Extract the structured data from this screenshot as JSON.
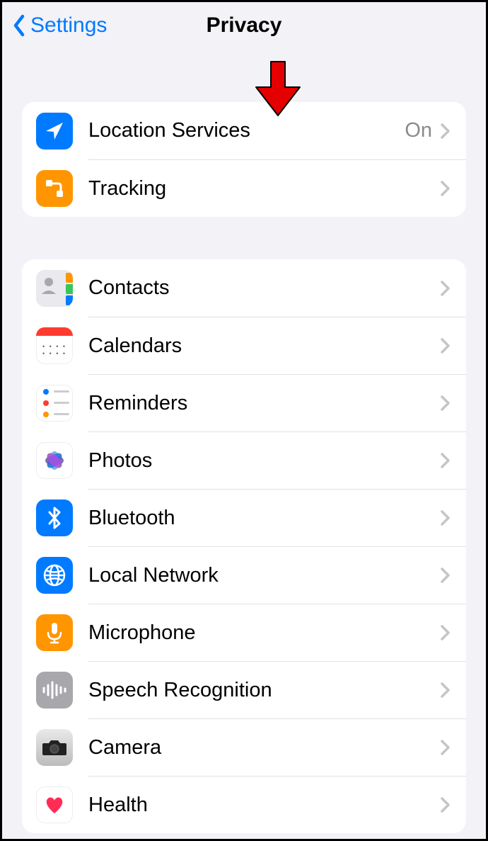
{
  "header": {
    "back_label": "Settings",
    "title": "Privacy"
  },
  "groups": [
    {
      "id": "location",
      "rows": [
        {
          "id": "location-services",
          "label": "Location Services",
          "value": "On",
          "icon": "location"
        },
        {
          "id": "tracking",
          "label": "Tracking",
          "icon": "tracking"
        }
      ]
    },
    {
      "id": "privacy-apps",
      "rows": [
        {
          "id": "contacts",
          "label": "Contacts",
          "icon": "contacts"
        },
        {
          "id": "calendars",
          "label": "Calendars",
          "icon": "calendars"
        },
        {
          "id": "reminders",
          "label": "Reminders",
          "icon": "reminders"
        },
        {
          "id": "photos",
          "label": "Photos",
          "icon": "photos"
        },
        {
          "id": "bluetooth",
          "label": "Bluetooth",
          "icon": "bluetooth"
        },
        {
          "id": "local-network",
          "label": "Local Network",
          "icon": "localnetwork"
        },
        {
          "id": "microphone",
          "label": "Microphone",
          "icon": "microphone"
        },
        {
          "id": "speech",
          "label": "Speech Recognition",
          "icon": "speech"
        },
        {
          "id": "camera",
          "label": "Camera",
          "icon": "camera"
        },
        {
          "id": "health",
          "label": "Health",
          "icon": "health"
        }
      ]
    }
  ],
  "annotation": {
    "type": "down-arrow",
    "color": "#e40000"
  }
}
